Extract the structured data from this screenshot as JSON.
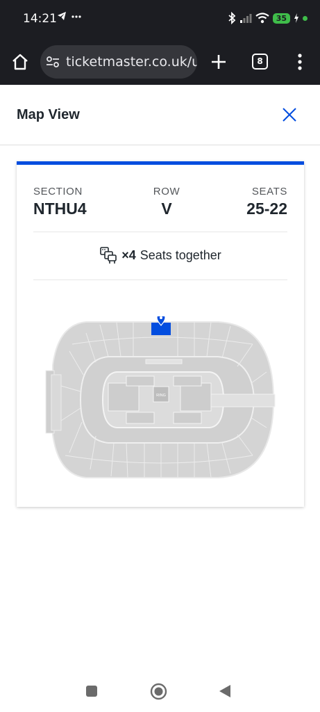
{
  "status_bar": {
    "time": "14:21",
    "battery": "35",
    "icons": [
      "telegram-icon",
      "more-dots-icon",
      "bluetooth-icon",
      "signal-icon",
      "wifi-icon",
      "battery-icon",
      "charging-icon"
    ]
  },
  "browser": {
    "url": "ticketmaster.co.uk/us",
    "tab_count": "8"
  },
  "page": {
    "title": "Map View"
  },
  "ticket": {
    "section_label": "SECTION",
    "section_value": "NTHU4",
    "row_label": "ROW",
    "row_value": "V",
    "seats_label": "SEATS",
    "seats_value": "25-22",
    "together_count": "×4",
    "together_text": "Seats together"
  },
  "map": {
    "stage_label": "RING",
    "selected_color": "#024ddf",
    "seat_color": "#d4d4d4"
  },
  "colors": {
    "accent": "#024ddf",
    "dark_bar": "#1c1d22"
  }
}
